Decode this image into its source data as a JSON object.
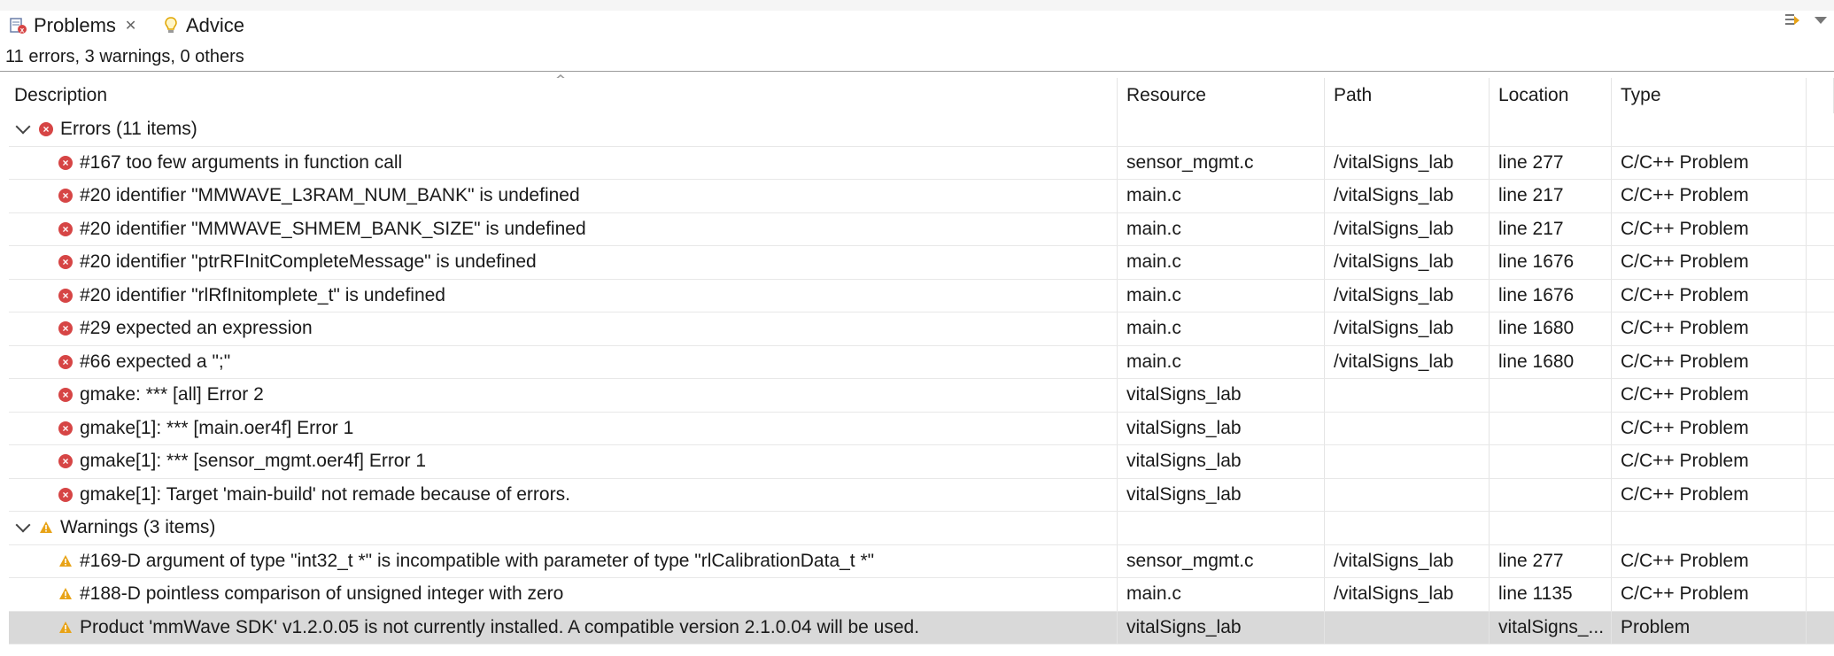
{
  "tabs": [
    {
      "label": "Problems",
      "active": true,
      "icon": "problems-icon"
    },
    {
      "label": "Advice",
      "active": false,
      "icon": "lightbulb-icon"
    }
  ],
  "summary": "11 errors, 3 warnings, 0 others",
  "columns": [
    "Description",
    "Resource",
    "Path",
    "Location",
    "Type"
  ],
  "groups": [
    {
      "label": "Errors (11 items)",
      "icon": "error-icon",
      "items": [
        {
          "desc": "#167 too few arguments in function call",
          "resource": "sensor_mgmt.c",
          "path": "/vitalSigns_lab",
          "location": "line 277",
          "type": "C/C++ Problem"
        },
        {
          "desc": "#20 identifier \"MMWAVE_L3RAM_NUM_BANK\" is undefined",
          "resource": "main.c",
          "path": "/vitalSigns_lab",
          "location": "line 217",
          "type": "C/C++ Problem"
        },
        {
          "desc": "#20 identifier \"MMWAVE_SHMEM_BANK_SIZE\" is undefined",
          "resource": "main.c",
          "path": "/vitalSigns_lab",
          "location": "line 217",
          "type": "C/C++ Problem"
        },
        {
          "desc": "#20 identifier \"ptrRFInitCompleteMessage\" is undefined",
          "resource": "main.c",
          "path": "/vitalSigns_lab",
          "location": "line 1676",
          "type": "C/C++ Problem"
        },
        {
          "desc": "#20 identifier \"rlRfInitomplete_t\" is undefined",
          "resource": "main.c",
          "path": "/vitalSigns_lab",
          "location": "line 1676",
          "type": "C/C++ Problem"
        },
        {
          "desc": "#29 expected an expression",
          "resource": "main.c",
          "path": "/vitalSigns_lab",
          "location": "line 1680",
          "type": "C/C++ Problem"
        },
        {
          "desc": "#66 expected a \";\"",
          "resource": "main.c",
          "path": "/vitalSigns_lab",
          "location": "line 1680",
          "type": "C/C++ Problem"
        },
        {
          "desc": "gmake: *** [all] Error 2",
          "resource": "vitalSigns_lab",
          "path": "",
          "location": "",
          "type": "C/C++ Problem"
        },
        {
          "desc": "gmake[1]: *** [main.oer4f] Error 1",
          "resource": "vitalSigns_lab",
          "path": "",
          "location": "",
          "type": "C/C++ Problem"
        },
        {
          "desc": "gmake[1]: *** [sensor_mgmt.oer4f] Error 1",
          "resource": "vitalSigns_lab",
          "path": "",
          "location": "",
          "type": "C/C++ Problem"
        },
        {
          "desc": "gmake[1]: Target 'main-build' not remade because of errors.",
          "resource": "vitalSigns_lab",
          "path": "",
          "location": "",
          "type": "C/C++ Problem"
        }
      ]
    },
    {
      "label": "Warnings (3 items)",
      "icon": "warning-icon",
      "items": [
        {
          "desc": "#169-D argument of type \"int32_t *\" is incompatible with parameter of type \"rlCalibrationData_t *\"",
          "resource": "sensor_mgmt.c",
          "path": "/vitalSigns_lab",
          "location": "line 277",
          "type": "C/C++ Problem"
        },
        {
          "desc": "#188-D pointless comparison of unsigned integer with zero",
          "resource": "main.c",
          "path": "/vitalSigns_lab",
          "location": "line 1135",
          "type": "C/C++ Problem"
        },
        {
          "desc": "Product 'mmWave SDK' v1.2.0.05 is not currently installed. A compatible version 2.1.0.04 will be used.",
          "resource": "vitalSigns_lab",
          "path": "",
          "location": "vitalSigns_...",
          "type": "Problem",
          "selected": true
        }
      ]
    }
  ],
  "colors": {
    "error": "#d64545",
    "warning": "#e8a317",
    "selection": "#d9d9d9"
  }
}
